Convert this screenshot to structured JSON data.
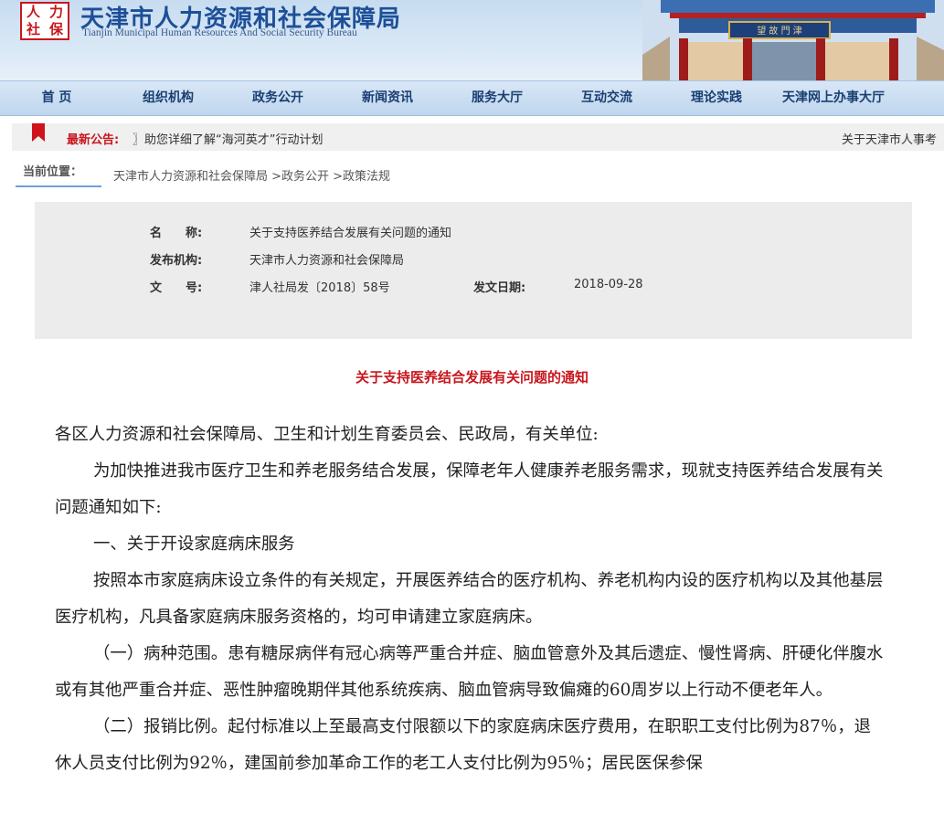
{
  "header": {
    "logo_chars": [
      "人",
      "力",
      "社",
      "保"
    ],
    "title": "天津市人力资源和社会保障局",
    "subtitle": "Tianjin Municipal Human Resources And Social Security Bureau",
    "gate_sign": "望 故 門 津"
  },
  "nav": [
    "首 页",
    "组织机构",
    "政务公开",
    "新闻资讯",
    "服务大厅",
    "互动交流",
    "理论实践",
    "天津网上办事大厅"
  ],
  "notice": {
    "label": "最新公告:",
    "text": "〗助您详细了解“海河英才”行动计划",
    "right": "关于天津市人事考"
  },
  "breadcrumb": {
    "label": "当前位置：",
    "path": "天津市人力资源和社会保障局 >政务公开 >政策法规"
  },
  "info": {
    "name_label": "名　　称:",
    "name": "关于支持医养结合发展有关问题的通知",
    "org_label": "发布机构:",
    "org": "天津市人力资源和社会保障局",
    "docno_label": "文　　号:",
    "docno": "津人社局发〔2018〕58号",
    "date_label": "发文日期:",
    "date": "2018-09-28"
  },
  "article": {
    "title": "关于支持医养结合发展有关问题的通知",
    "salutation": "各区人力资源和社会保障局、卫生和计划生育委员会、民政局，有关单位:",
    "intro": "为加快推进我市医疗卫生和养老服务结合发展，保障老年人健康养老服务需求，现就支持医养结合发展有关问题通知如下:",
    "section1": "一、关于开设家庭病床服务",
    "section1_body": "按照本市家庭病床设立条件的有关规定，开展医养结合的医疗机构、养老机构内设的医疗机构以及其他基层医疗机构，凡具备家庭病床服务资格的，均可申请建立家庭病床。",
    "item1_head": "（一）病种范围。",
    "item1_body": "患有糖尿病伴有冠心病等严重合并症、脑血管意外及其后遗症、慢性肾病、肝硬化伴腹水或有其他严重合并症、恶性肿瘤晚期伴其他系统疾病、脑血管病导致偏瘫的60周岁以上行动不便老年人。",
    "item2_head": "（二）报销比例。",
    "item2_body": "起付标准以上至最高支付限额以下的家庭病床医疗费用，在职职工支付比例为87％，退休人员支付比例为92％，建国前参加革命工作的老工人支付比例为95％；居民医保参保"
  }
}
